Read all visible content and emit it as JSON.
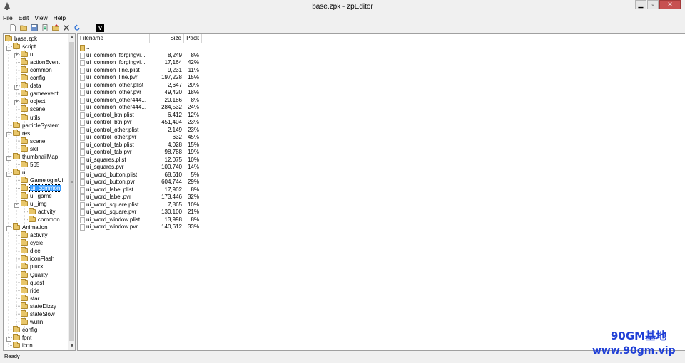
{
  "window": {
    "title": "base.zpk - zpEditor"
  },
  "menu": [
    "File",
    "Edit",
    "View",
    "Help"
  ],
  "toolbar": {
    "v_label": "V"
  },
  "tree": [
    {
      "label": "base.zpk",
      "icon": "folder-icon"
    },
    {
      "label": "script",
      "icon": "folder-icon"
    },
    {
      "label": "ui",
      "icon": "folder-icon"
    },
    {
      "label": "actionEvent",
      "icon": "folder-icon"
    },
    {
      "label": "common",
      "icon": "folder-icon"
    },
    {
      "label": "config",
      "icon": "folder-icon"
    },
    {
      "label": "data",
      "icon": "folder-icon"
    },
    {
      "label": "gameevent",
      "icon": "folder-icon"
    },
    {
      "label": "object",
      "icon": "folder-icon"
    },
    {
      "label": "scene",
      "icon": "folder-icon"
    },
    {
      "label": "utils",
      "icon": "folder-icon"
    },
    {
      "label": "particleSystem",
      "icon": "folder-icon"
    },
    {
      "label": "res",
      "icon": "folder-icon"
    },
    {
      "label": "scene",
      "icon": "folder-icon"
    },
    {
      "label": "skill",
      "icon": "folder-icon"
    },
    {
      "label": "thumbnailMap",
      "icon": "folder-icon"
    },
    {
      "label": "565",
      "icon": "folder-icon"
    },
    {
      "label": "ui",
      "icon": "folder-icon"
    },
    {
      "label": "GameloginUi",
      "icon": "folder-icon"
    },
    {
      "label": "ui_common",
      "icon": "folder-icon",
      "selected": true
    },
    {
      "label": "ui_game",
      "icon": "folder-icon"
    },
    {
      "label": "ui_img",
      "icon": "folder-icon"
    },
    {
      "label": "activity",
      "icon": "folder-icon"
    },
    {
      "label": "common",
      "icon": "folder-icon"
    },
    {
      "label": "Animation",
      "icon": "folder-icon"
    },
    {
      "label": "activity",
      "icon": "folder-icon"
    },
    {
      "label": "cycle",
      "icon": "folder-icon"
    },
    {
      "label": "dice",
      "icon": "folder-icon"
    },
    {
      "label": "iconFlash",
      "icon": "folder-icon"
    },
    {
      "label": "pluck",
      "icon": "folder-icon"
    },
    {
      "label": "Quality",
      "icon": "folder-icon"
    },
    {
      "label": "quest",
      "icon": "folder-icon"
    },
    {
      "label": "ride",
      "icon": "folder-icon"
    },
    {
      "label": "star",
      "icon": "folder-icon"
    },
    {
      "label": "stateDizzy",
      "icon": "folder-icon"
    },
    {
      "label": "stateSlow",
      "icon": "folder-icon"
    },
    {
      "label": "wulin",
      "icon": "folder-icon"
    },
    {
      "label": "config",
      "icon": "folder-icon"
    },
    {
      "label": "font",
      "icon": "folder-icon"
    },
    {
      "label": "icon",
      "icon": "folder-icon"
    }
  ],
  "list": {
    "columns": {
      "name": "Filename",
      "size": "Size",
      "pack": "Pack"
    },
    "up_label": "..",
    "files": [
      {
        "name": "ui_common_forgingvi...",
        "size": "8,249",
        "pack": "8%"
      },
      {
        "name": "ui_common_forgingvi...",
        "size": "17,164",
        "pack": "42%"
      },
      {
        "name": "ui_common_line.plist",
        "size": "9,231",
        "pack": "11%"
      },
      {
        "name": "ui_common_line.pvr",
        "size": "197,228",
        "pack": "15%"
      },
      {
        "name": "ui_common_other.plist",
        "size": "2,647",
        "pack": "20%"
      },
      {
        "name": "ui_common_other.pvr",
        "size": "49,420",
        "pack": "18%"
      },
      {
        "name": "ui_common_other444...",
        "size": "20,186",
        "pack": "8%"
      },
      {
        "name": "ui_common_other444...",
        "size": "284,532",
        "pack": "24%"
      },
      {
        "name": "ui_control_btn.plist",
        "size": "6,412",
        "pack": "12%"
      },
      {
        "name": "ui_control_btn.pvr",
        "size": "451,404",
        "pack": "23%"
      },
      {
        "name": "ui_control_other.plist",
        "size": "2,149",
        "pack": "23%"
      },
      {
        "name": "ui_control_other.pvr",
        "size": "632",
        "pack": "45%"
      },
      {
        "name": "ui_control_tab.plist",
        "size": "4,028",
        "pack": "15%"
      },
      {
        "name": "ui_control_tab.pvr",
        "size": "98,788",
        "pack": "19%"
      },
      {
        "name": "ui_squares.plist",
        "size": "12,075",
        "pack": "10%"
      },
      {
        "name": "ui_squares.pvr",
        "size": "100,740",
        "pack": "14%"
      },
      {
        "name": "ui_word_button.plist",
        "size": "68,610",
        "pack": "5%"
      },
      {
        "name": "ui_word_button.pvr",
        "size": "604,744",
        "pack": "29%"
      },
      {
        "name": "ui_word_label.plist",
        "size": "17,902",
        "pack": "8%"
      },
      {
        "name": "ui_word_label.pvr",
        "size": "173,446",
        "pack": "32%"
      },
      {
        "name": "ui_word_square.plist",
        "size": "7,865",
        "pack": "10%"
      },
      {
        "name": "ui_word_square.pvr",
        "size": "130,100",
        "pack": "21%"
      },
      {
        "name": "ui_word_window.plist",
        "size": "13,998",
        "pack": "8%"
      },
      {
        "name": "ui_word_window.pvr",
        "size": "140,612",
        "pack": "33%"
      }
    ]
  },
  "status": {
    "text": "Ready"
  },
  "watermark": {
    "line1": "90GM基地",
    "line2": "www.90gm.vip"
  }
}
